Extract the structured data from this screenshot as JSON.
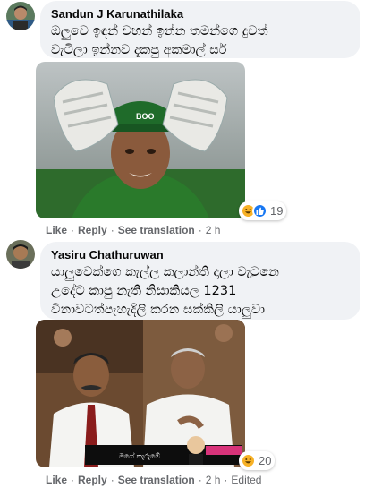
{
  "comments": [
    {
      "author": "Sandun J Karunathilaka",
      "text": "ඔලුවෙ ඉඳන් වහන් ඉන්න තමන්ගෙ දුවත්\nවැටිලා ඉන්නව දැකපු අකමාල් සර්",
      "photo_icon": "meme-photo-cricket-keeper",
      "reaction_icons": [
        "haha-icon",
        "like-icon"
      ],
      "reaction_count": "19",
      "actions": {
        "like": "Like",
        "reply": "Reply",
        "translate": "See translation",
        "time": "2 h",
        "edited": ""
      }
    },
    {
      "author": "Yasiru Chathuruwan",
      "text": "යාලුවෙක්ගෙ කැල්ල කලාන්ති දාලා වැටුනෙ\nඋදේට කාපු නැති නිසාකියල 1231\nවිනාවටත්පැහැදිලි කරන සක්කිලි යාලුවා",
      "photo_icon": "meme-photo-politicians",
      "photo_caption": "මගේ කැරුමේ",
      "reaction_icons": [
        "haha-icon"
      ],
      "reaction_count": "20",
      "actions": {
        "like": "Like",
        "reply": "Reply",
        "translate": "See translation",
        "time": "2 h",
        "edited": "Edited"
      }
    }
  ],
  "colors": {
    "bubble": "#f0f2f5",
    "meta": "#65676b",
    "like": "#1877f2",
    "haha": "#f7b125"
  }
}
